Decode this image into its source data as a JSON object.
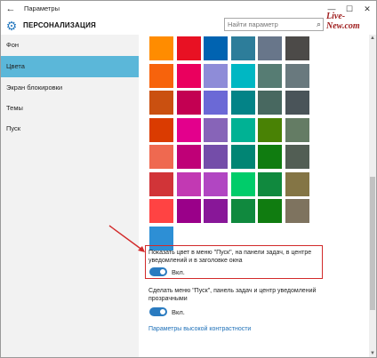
{
  "window": {
    "back_glyph": "←",
    "title": "Параметры",
    "controls": {
      "minimize": "—",
      "maximize": "☐",
      "close": "✕"
    }
  },
  "header": {
    "gear_glyph": "⚙",
    "section_title": "ПЕРСОНАЛИЗАЦИЯ",
    "search_placeholder": "Найти параметр",
    "search_glyph": "⌕",
    "watermark": "Live-New.com"
  },
  "sidebar": {
    "items": [
      {
        "label": "Фон",
        "active": false
      },
      {
        "label": "Цвета",
        "active": true
      },
      {
        "label": "Экран блокировки",
        "active": false
      },
      {
        "label": "Темы",
        "active": false
      },
      {
        "label": "Пуск",
        "active": false
      }
    ]
  },
  "palette": {
    "rows": [
      [
        "#ff8c00",
        "#e81123",
        "#0063b1",
        "#2d7d9a",
        "#68768a",
        "#4c4a48"
      ],
      [
        "#f7630c",
        "#ea005e",
        "#8e8cd8",
        "#00b7c3",
        "#567c73",
        "#69797e"
      ],
      [
        "#ca5010",
        "#c30052",
        "#6b69d6",
        "#038387",
        "#486860",
        "#4a5459"
      ],
      [
        "#da3b01",
        "#e3008c",
        "#8764b8",
        "#00b294",
        "#498205",
        "#647c64"
      ],
      [
        "#ef6950",
        "#bf0077",
        "#744da9",
        "#018574",
        "#107c10",
        "#525e54"
      ],
      [
        "#d13438",
        "#c239b3",
        "#b146c2",
        "#00cc6a",
        "#10893e",
        "#847545"
      ],
      [
        "#ff4343",
        "#9a0089",
        "#881798",
        "#10893e",
        "#107c10",
        "#7e735f"
      ],
      [
        "#2d8fd5"
      ]
    ]
  },
  "options": {
    "show_color": {
      "text_line1": "Показать цвет в меню \"Пуск\", на панели задач, в центре",
      "text_line2": "уведомлений и в заголовке окна",
      "toggle_label": "Вкл.",
      "on": true
    },
    "transparency": {
      "text_line1": "Сделать меню \"Пуск\", панель задач и центр уведомлений",
      "text_line2": "прозрачными",
      "toggle_label": "Вкл.",
      "on": true
    },
    "high_contrast_link": "Параметры высокой контрастности"
  },
  "colors": {
    "accent": "#2a7bc0",
    "sidebar_active": "#5bb7d9",
    "annotation_red": "#d22a2a"
  }
}
